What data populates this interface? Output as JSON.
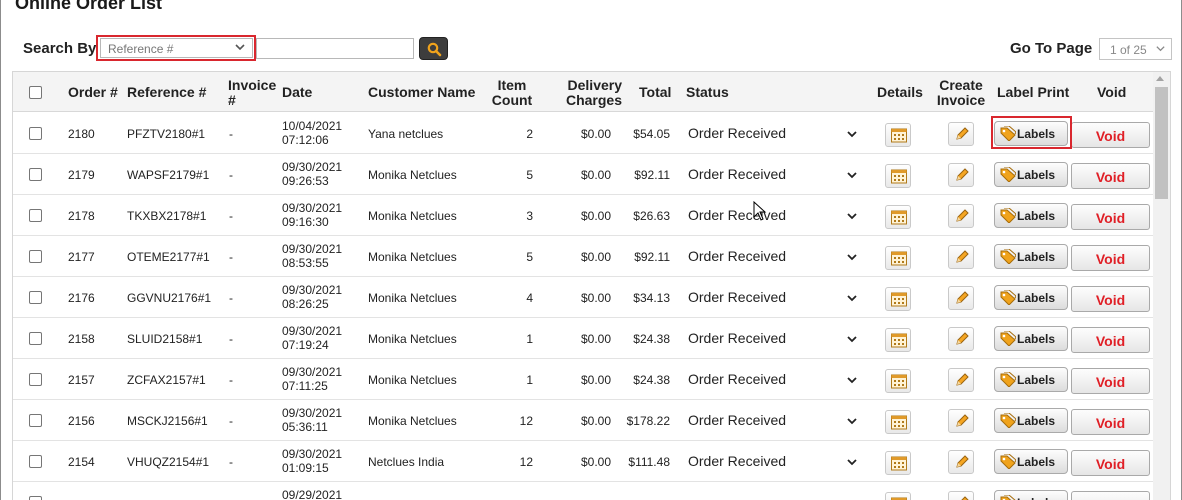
{
  "page": {
    "title": "Online Order List"
  },
  "search": {
    "label": "Search By",
    "select_value": "Reference #",
    "input_value": ""
  },
  "pagination": {
    "label": "Go To Page",
    "value": "1 of 25"
  },
  "table": {
    "headers": {
      "order": "Order #",
      "reference": "Reference #",
      "invoice_l1": "Invoice",
      "invoice_l2": "#",
      "date": "Date",
      "customer": "Customer Name",
      "item_l1": "Item",
      "item_l2": "Count",
      "delivery_l1": "Delivery",
      "delivery_l2": "Charges",
      "total": "Total",
      "status": "Status",
      "details": "Details",
      "create_l1": "Create",
      "create_l2": "Invoice",
      "label_print": "Label Print",
      "void": "Void"
    },
    "labels_button": "Labels",
    "void_button": "Void",
    "rows": [
      {
        "order": "2180",
        "reference": "PFZTV2180#1",
        "invoice": "-",
        "date": "10/04/2021",
        "time": "07:12:06",
        "customer": "Yana netclues",
        "items": "2",
        "delivery": "$0.00",
        "total": "$54.05",
        "status": "Order Received"
      },
      {
        "order": "2179",
        "reference": "WAPSF2179#1",
        "invoice": "-",
        "date": "09/30/2021",
        "time": "09:26:53",
        "customer": "Monika Netclues",
        "items": "5",
        "delivery": "$0.00",
        "total": "$92.11",
        "status": "Order Received"
      },
      {
        "order": "2178",
        "reference": "TKXBX2178#1",
        "invoice": "-",
        "date": "09/30/2021",
        "time": "09:16:30",
        "customer": "Monika Netclues",
        "items": "3",
        "delivery": "$0.00",
        "total": "$26.63",
        "status": "Order Received"
      },
      {
        "order": "2177",
        "reference": "OTEME2177#1",
        "invoice": "-",
        "date": "09/30/2021",
        "time": "08:53:55",
        "customer": "Monika Netclues",
        "items": "5",
        "delivery": "$0.00",
        "total": "$92.11",
        "status": "Order Received"
      },
      {
        "order": "2176",
        "reference": "GGVNU2176#1",
        "invoice": "-",
        "date": "09/30/2021",
        "time": "08:26:25",
        "customer": "Monika Netclues",
        "items": "4",
        "delivery": "$0.00",
        "total": "$34.13",
        "status": "Order Received"
      },
      {
        "order": "2158",
        "reference": "SLUID2158#1",
        "invoice": "-",
        "date": "09/30/2021",
        "time": "07:19:24",
        "customer": "Monika Netclues",
        "items": "1",
        "delivery": "$0.00",
        "total": "$24.38",
        "status": "Order Received"
      },
      {
        "order": "2157",
        "reference": "ZCFAX2157#1",
        "invoice": "-",
        "date": "09/30/2021",
        "time": "07:11:25",
        "customer": "Monika Netclues",
        "items": "1",
        "delivery": "$0.00",
        "total": "$24.38",
        "status": "Order Received"
      },
      {
        "order": "2156",
        "reference": "MSCKJ2156#1",
        "invoice": "-",
        "date": "09/30/2021",
        "time": "05:36:11",
        "customer": "Monika Netclues",
        "items": "12",
        "delivery": "$0.00",
        "total": "$178.22",
        "status": "Order Received"
      },
      {
        "order": "2154",
        "reference": "VHUQZ2154#1",
        "invoice": "-",
        "date": "09/30/2021",
        "time": "01:09:15",
        "customer": "Netclues India",
        "items": "12",
        "delivery": "$0.00",
        "total": "$111.48",
        "status": "Order Received"
      },
      {
        "order": "",
        "reference": "",
        "invoice": "",
        "date": "09/29/2021",
        "time": "",
        "customer": "",
        "items": "",
        "delivery": "",
        "total": "",
        "status": ""
      }
    ]
  },
  "colors": {
    "accent_orange": "#f0a31c",
    "void_red": "#e01f26",
    "highlight_red": "#d9272e",
    "header_bg": "#f4f4f4"
  }
}
